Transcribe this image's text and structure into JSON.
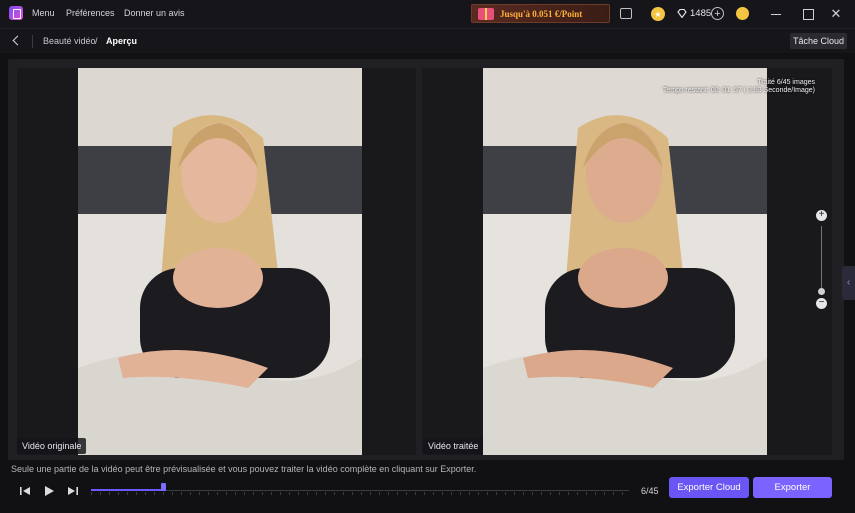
{
  "titlebar": {
    "menu_label": "Menu",
    "preferences_label": "Préférences",
    "feedback_label": "Donner un avis",
    "promo_text": "Jusqu'à 0.051 €/Point",
    "credits": "1485"
  },
  "nav": {
    "breadcrumb_parent": "Beauté vidéo",
    "breadcrumb_separator": "/",
    "breadcrumb_current": "Aperçu",
    "cloud_task_label": "Tâche Cloud"
  },
  "preview": {
    "original_label": "Vidéo originale",
    "processed_label": "Vidéo traitée",
    "progress_line": "Traité 6/45 images",
    "remaining_line": "Temps restant: 00: 01: 57 ( 3.53 Seconde/Image)"
  },
  "footer": {
    "hint": "Seule une partie de la vidéo peut être prévisualisée et vous pouvez traiter la vidéo complète en cliquant sur Exporter.",
    "frame_counter": "6/45",
    "export_cloud_label": "Exporter Cloud",
    "export_label": "Exporter",
    "frames_processed": 6,
    "frames_total": 45
  },
  "colors": {
    "accent": "#7a63ff",
    "promo_text": "#ffb23a",
    "background": "#111114"
  },
  "icons": {
    "app": "app-logo-icon",
    "messages": "message-icon",
    "coin": "coin-icon",
    "credits": "gem-icon",
    "add": "plus-circle-icon",
    "user": "user-avatar-icon",
    "back": "chevron-left-icon"
  }
}
